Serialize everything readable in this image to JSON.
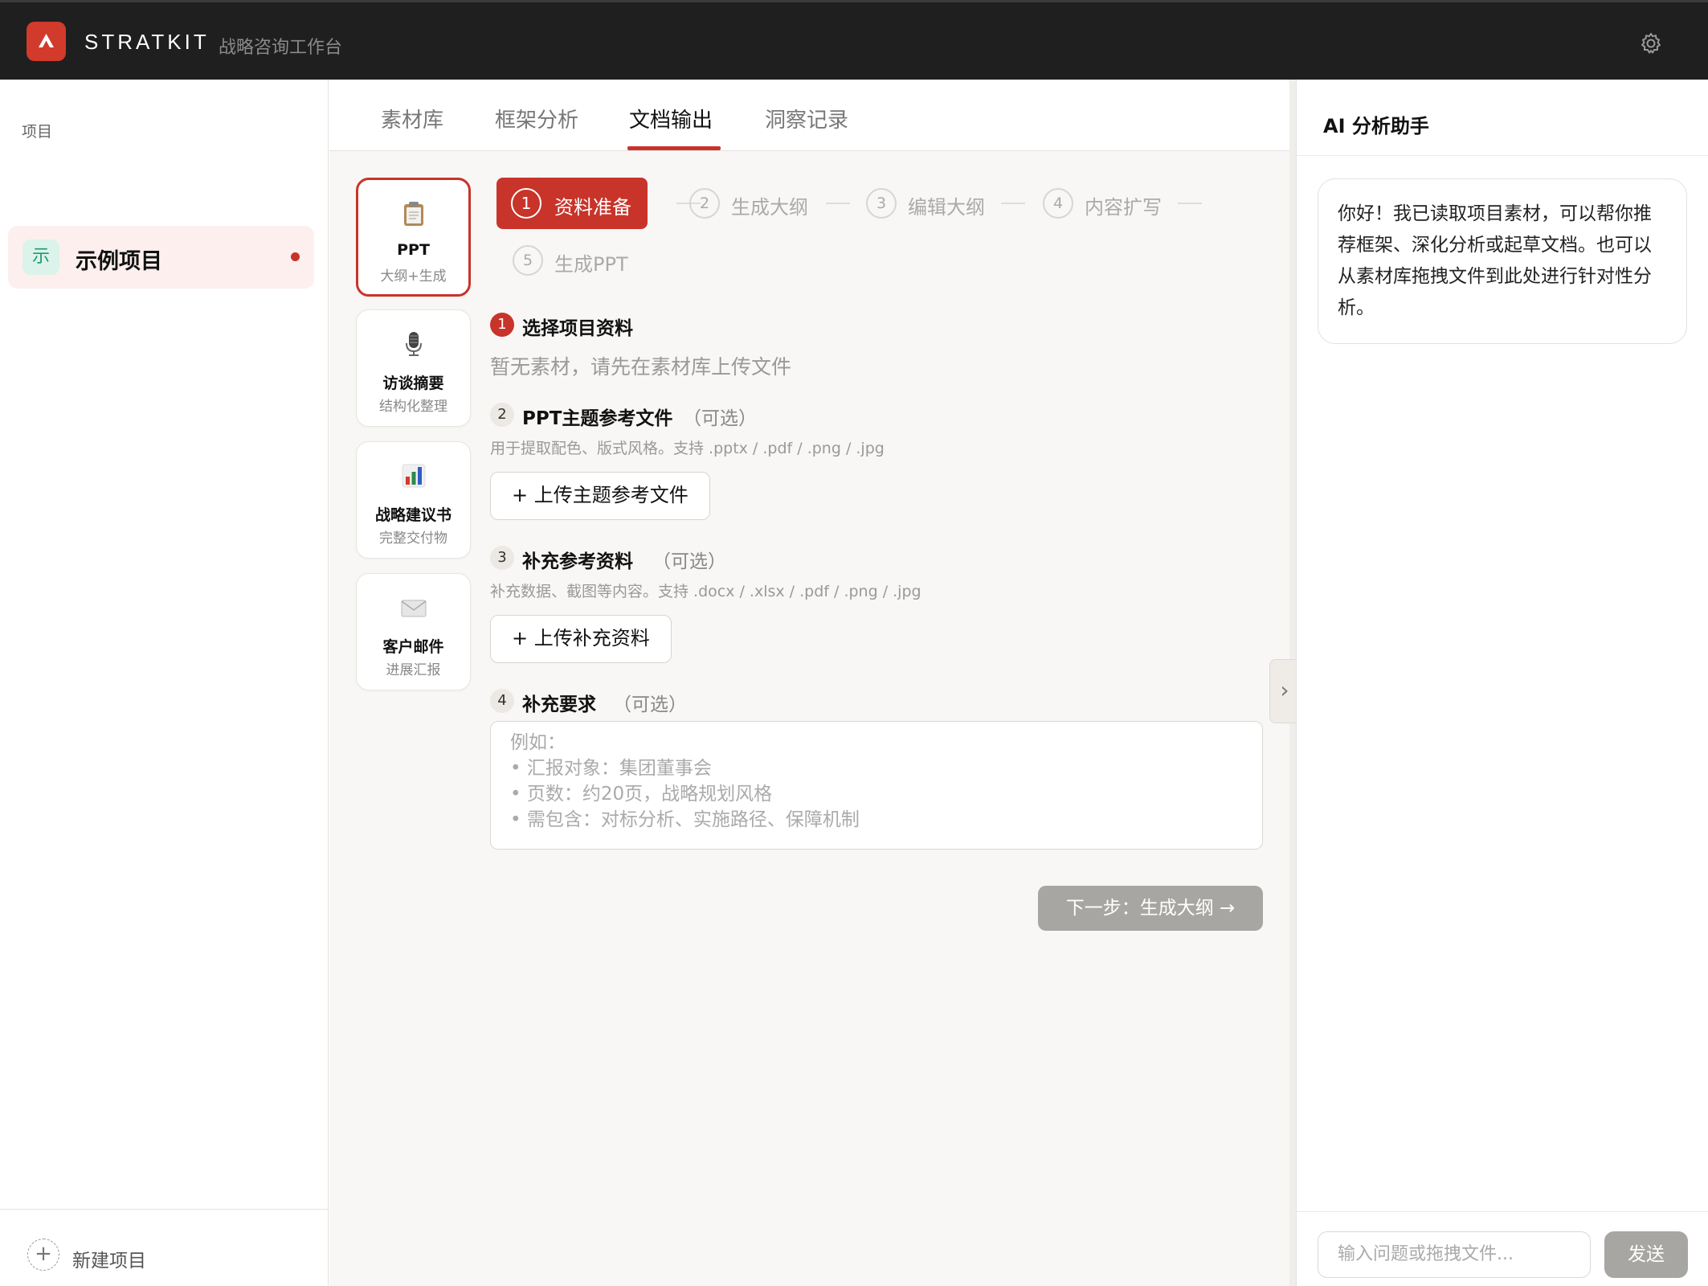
{
  "app": {
    "brand": "STRATKIT",
    "subtitle": "战略咨询工作台"
  },
  "sidebar": {
    "title": "项目",
    "projects": [
      {
        "avatar": "示",
        "name": "示例项目",
        "active": true
      }
    ],
    "new_project_label": "新建项目"
  },
  "tabs": [
    {
      "label": "素材库",
      "active": false
    },
    {
      "label": "框架分析",
      "active": false
    },
    {
      "label": "文档输出",
      "active": true
    },
    {
      "label": "洞察记录",
      "active": false
    }
  ],
  "doc_types": [
    {
      "icon": "clipboard-icon",
      "title": "PPT",
      "sub": "大纲+生成",
      "active": true
    },
    {
      "icon": "microphone-icon",
      "title": "访谈摘要",
      "sub": "结构化整理",
      "active": false
    },
    {
      "icon": "bar-chart-icon",
      "title": "战略建议书",
      "sub": "完整交付物",
      "active": false
    },
    {
      "icon": "envelope-icon",
      "title": "客户邮件",
      "sub": "进展汇报",
      "active": false
    }
  ],
  "steps": [
    {
      "num": "1",
      "label": "资料准备",
      "active": true
    },
    {
      "num": "2",
      "label": "生成大纲",
      "active": false
    },
    {
      "num": "3",
      "label": "编辑大纲",
      "active": false
    },
    {
      "num": "4",
      "label": "内容扩写",
      "active": false
    },
    {
      "num": "5",
      "label": "生成PPT",
      "active": false
    }
  ],
  "form": {
    "s1": {
      "num": "1",
      "title": "选择项目资料",
      "empty_hint": "暂无素材，请先在素材库上传文件"
    },
    "s2": {
      "num": "2",
      "title": "PPT主题参考文件",
      "optional": "（可选）",
      "hint": "用于提取配色、版式风格。支持 .pptx / .pdf / .png / .jpg",
      "button": "+ 上传主题参考文件"
    },
    "s3": {
      "num": "3",
      "title": "补充参考资料",
      "optional": "（可选）",
      "hint": "补充数据、截图等内容。支持 .docx / .xlsx / .pdf / .png / .jpg",
      "button": "+ 上传补充资料"
    },
    "s4": {
      "num": "4",
      "title": "补充要求",
      "optional": "（可选）",
      "placeholder": "例如：\n• 汇报对象：集团董事会\n• 页数：约20页，战略规划风格\n• 需包含：对标分析、实施路径、保障机制"
    },
    "next_button": "下一步：生成大纲 →"
  },
  "ai_panel": {
    "title": "AI 分析助手",
    "message": "你好！我已读取项目素材，可以帮你推荐框架、深化分析或起草文档。也可以从素材库拖拽文件到此处进行针对性分析。",
    "input_placeholder": "输入问题或拖拽文件...",
    "send_label": "发送"
  },
  "colors": {
    "accent": "#c8342a",
    "topbar": "#1f1f1f",
    "disabled_button": "#a8a6a3"
  }
}
